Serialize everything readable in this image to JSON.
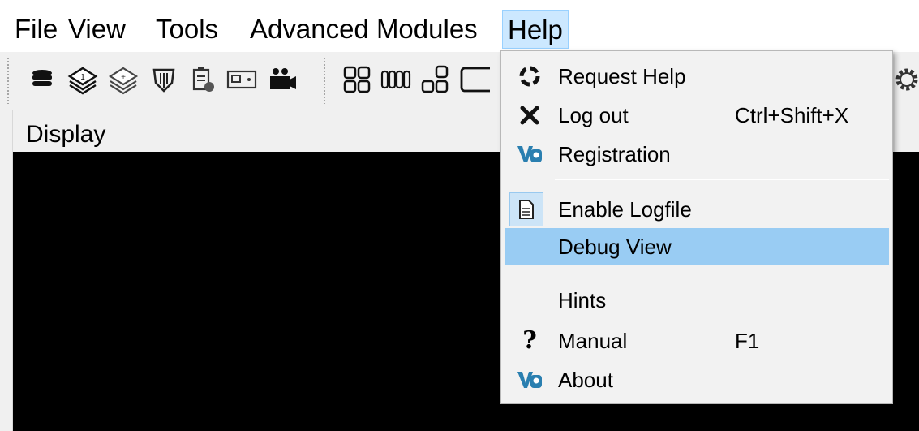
{
  "menubar": {
    "items": [
      {
        "label": "File"
      },
      {
        "label": "View"
      },
      {
        "label": "Tools"
      },
      {
        "label": "Advanced Modules"
      },
      {
        "label": "Help",
        "active": true
      }
    ]
  },
  "toolbar": {
    "icons": [
      "database-icon",
      "layer-stack-1-icon",
      "layer-stack-add-icon",
      "shield-network-icon",
      "clipboard-export-icon",
      "card-reader-icon",
      "video-camera-icon",
      "grid-2x2-icon",
      "grid-columns-icon",
      "layout-cascade-icon",
      "single-frame-icon",
      "settings-gear-icon"
    ]
  },
  "display": {
    "title": "Display"
  },
  "help_menu": {
    "items": [
      {
        "label": "Request Help",
        "icon": "lifebuoy-icon"
      },
      {
        "label": "Log out",
        "shortcut": "Ctrl+Shift+X",
        "icon": "close-x-icon"
      },
      {
        "label": "Registration",
        "icon": "app-logo-icon"
      },
      {
        "label": "Enable Logfile",
        "icon": "document-icon",
        "checked": true
      },
      {
        "label": "Debug View",
        "highlighted": true
      },
      {
        "label": "Hints"
      },
      {
        "label": "Manual",
        "shortcut": "F1",
        "icon": "question-mark-icon"
      },
      {
        "label": "About",
        "icon": "app-logo-icon"
      }
    ]
  },
  "colors": {
    "highlight": "#99ccf3",
    "menu_active": "#cce8ff",
    "display_bg": "#000000",
    "logo_teal": "#2a7fb0"
  }
}
